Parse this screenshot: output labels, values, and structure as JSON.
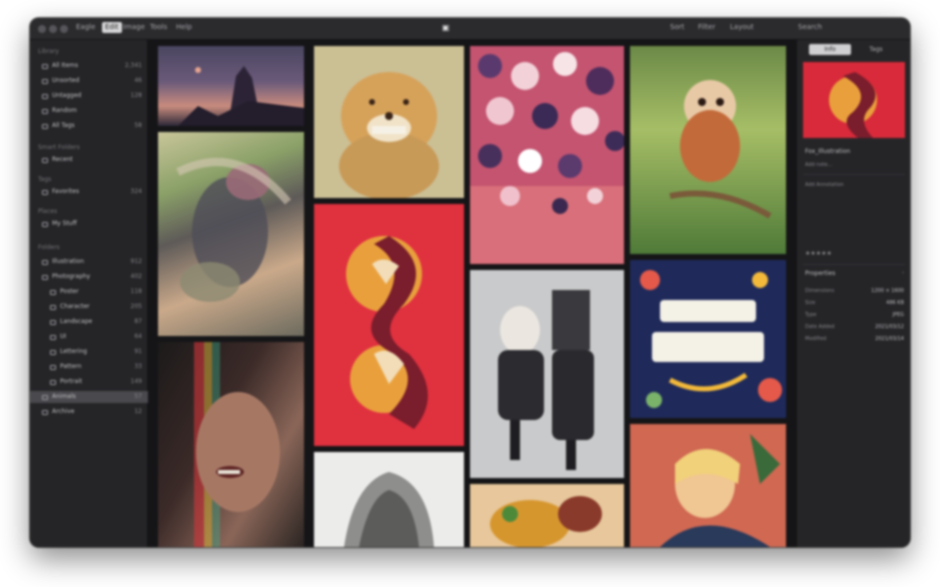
{
  "titlebar": {
    "menus": [
      "Eagle",
      "Edit",
      "Image",
      "Tools",
      "Help"
    ],
    "active_menu": "Edit",
    "right_items": [
      "Sort",
      "Filter",
      "Layout",
      "Search"
    ]
  },
  "sidebar": {
    "library_section": "Library",
    "library_items": [
      {
        "label": "All Items",
        "count": "2,341"
      },
      {
        "label": "Unsorted",
        "count": "46"
      },
      {
        "label": "Untagged",
        "count": "128"
      },
      {
        "label": "Random",
        "count": ""
      },
      {
        "label": "All Tags",
        "count": "58"
      }
    ],
    "section_2": "Smart Folders",
    "section_2_items": [
      {
        "label": "Recent",
        "count": ""
      }
    ],
    "section_3": "Tags",
    "section_3_items": [
      {
        "label": "Favorites",
        "count": "324"
      }
    ],
    "section_4": "Places",
    "section_4_items": [
      {
        "label": "My Stuff",
        "count": ""
      }
    ],
    "folders_section": "Folders",
    "folder_items": [
      {
        "label": "Illustration",
        "count": "912",
        "indent": false
      },
      {
        "label": "Photography",
        "count": "402",
        "indent": false
      },
      {
        "label": "Poster",
        "count": "118",
        "indent": true
      },
      {
        "label": "Character",
        "count": "205",
        "indent": true
      },
      {
        "label": "Landscape",
        "count": "87",
        "indent": true
      },
      {
        "label": "UI",
        "count": "64",
        "indent": true
      },
      {
        "label": "Lettering",
        "count": "91",
        "indent": true
      },
      {
        "label": "Pattern",
        "count": "33",
        "indent": true
      },
      {
        "label": "Portrait",
        "count": "149",
        "indent": true
      },
      {
        "label": "Animals",
        "count": "57",
        "indent": false
      },
      {
        "label": "Archive",
        "count": "12",
        "indent": false
      }
    ],
    "selected_index": 9
  },
  "inspector": {
    "tabs": [
      "Info",
      "Tags"
    ],
    "active_tab": "Info",
    "title": "Fox_Illustration",
    "subtitle": "Add note...",
    "annotation": "Add Annotation",
    "rating_stars": "★★★★★",
    "section": "Properties",
    "properties": [
      {
        "key": "Dimensions",
        "value": "1200 × 1600"
      },
      {
        "key": "Size",
        "value": "486 KB"
      },
      {
        "key": "Type",
        "value": "JPEG"
      },
      {
        "key": "Date Added",
        "value": "2021/03/12"
      },
      {
        "key": "Modified",
        "value": "2021/03/14"
      }
    ]
  },
  "colors": {
    "window_bg": "#1e1e21",
    "sidebar_bg": "#252528",
    "gallery_bg": "#151517",
    "selection": "#4a4a4e"
  }
}
